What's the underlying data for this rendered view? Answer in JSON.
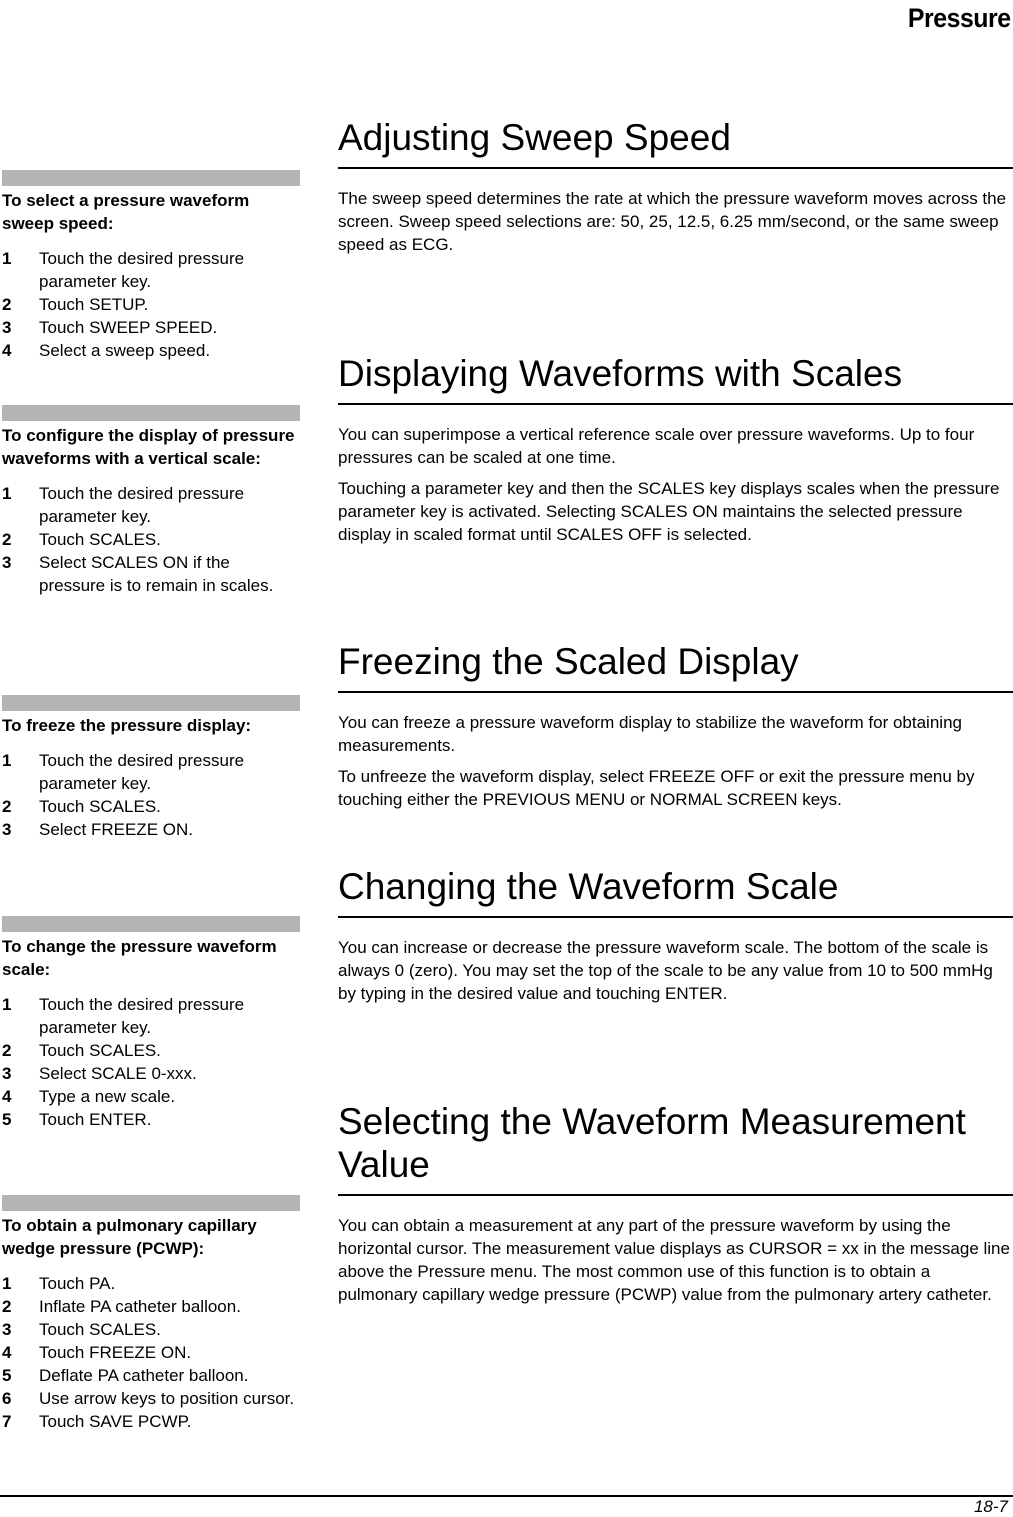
{
  "header": {
    "running_title": "Pressure"
  },
  "sidebar": [
    {
      "title": "To select a pressure waveform sweep speed:",
      "steps": [
        {
          "num": "1",
          "text": "Touch the desired pressure parameter key."
        },
        {
          "num": "2",
          "text": "Touch SETUP."
        },
        {
          "num": "3",
          "text": "Touch SWEEP SPEED."
        },
        {
          "num": "4",
          "text": "Select a sweep speed."
        }
      ]
    },
    {
      "title": "To configure the display of pressure waveforms with a vertical scale:",
      "steps": [
        {
          "num": "1",
          "text": "Touch the desired pressure parameter key."
        },
        {
          "num": "2",
          "text": "Touch SCALES."
        },
        {
          "num": "3",
          "text": "Select SCALES ON if the pressure is to remain in scales."
        }
      ]
    },
    {
      "title": "To freeze the pressure display:",
      "steps": [
        {
          "num": "1",
          "text": "Touch the desired pressure parameter key."
        },
        {
          "num": "2",
          "text": "Touch SCALES."
        },
        {
          "num": "3",
          "text": "Select FREEZE ON."
        }
      ]
    },
    {
      "title": "To change the pressure waveform scale:",
      "steps": [
        {
          "num": "1",
          "text": "Touch the desired pressure parameter key."
        },
        {
          "num": "2",
          "text": "Touch SCALES."
        },
        {
          "num": "3",
          "text": "Select SCALE 0-xxx."
        },
        {
          "num": "4",
          "text": "Type a new scale."
        },
        {
          "num": "5",
          "text": "Touch ENTER."
        }
      ]
    },
    {
      "title": "To obtain a pulmonary capillary wedge pressure (PCWP):",
      "steps": [
        {
          "num": "1",
          "text": "Touch PA."
        },
        {
          "num": "2",
          "text": "Inflate PA catheter balloon."
        },
        {
          "num": "3",
          "text": "Touch SCALES."
        },
        {
          "num": "4",
          "text": "Touch FREEZE ON."
        },
        {
          "num": "5",
          "text": "Deflate PA catheter balloon."
        },
        {
          "num": "6",
          "text": "Use arrow keys to position cursor."
        },
        {
          "num": "7",
          "text": "Touch SAVE PCWP."
        }
      ]
    }
  ],
  "sections": [
    {
      "title": "Adjusting Sweep Speed",
      "paragraphs": [
        "The sweep speed determines the rate at which the pressure waveform moves across the screen. Sweep speed selections are: 50, 25, 12.5, 6.25 mm/second, or the same sweep speed as ECG."
      ]
    },
    {
      "title": "Displaying Waveforms with Scales",
      "paragraphs": [
        "You can superimpose a vertical reference scale over pressure waveforms. Up to four pressures can be scaled at one time.",
        "Touching a parameter key and then the SCALES key displays scales when the pressure parameter key is activated. Selecting SCALES ON maintains the selected pressure display in scaled format until SCALES OFF is selected."
      ]
    },
    {
      "title": "Freezing the Scaled Display",
      "paragraphs": [
        "You can freeze a pressure waveform display to stabilize the waveform for obtaining measurements.",
        "To unfreeze the waveform display, select FREEZE OFF or exit the pressure menu by touching either the PREVIOUS MENU or NORMAL SCREEN keys."
      ]
    },
    {
      "title": "Changing the Waveform Scale",
      "paragraphs": [
        "You can increase or decrease the pressure waveform scale. The bottom of the scale is always 0 (zero). You may set the top of the scale to be any value from 10 to 500 mmHg by typing in the desired value and touching ENTER."
      ]
    },
    {
      "title": "Selecting the Waveform Measurement Value",
      "paragraphs": [
        "You can obtain a measurement at any part of the pressure waveform by using the horizontal cursor. The measurement value displays as CURSOR = xx in the message line above the Pressure menu. The most common use of this function is to obtain a pulmonary capillary wedge pressure (PCWP) value from the pulmonary artery catheter."
      ]
    }
  ],
  "footer": {
    "page_number": "18-7"
  }
}
